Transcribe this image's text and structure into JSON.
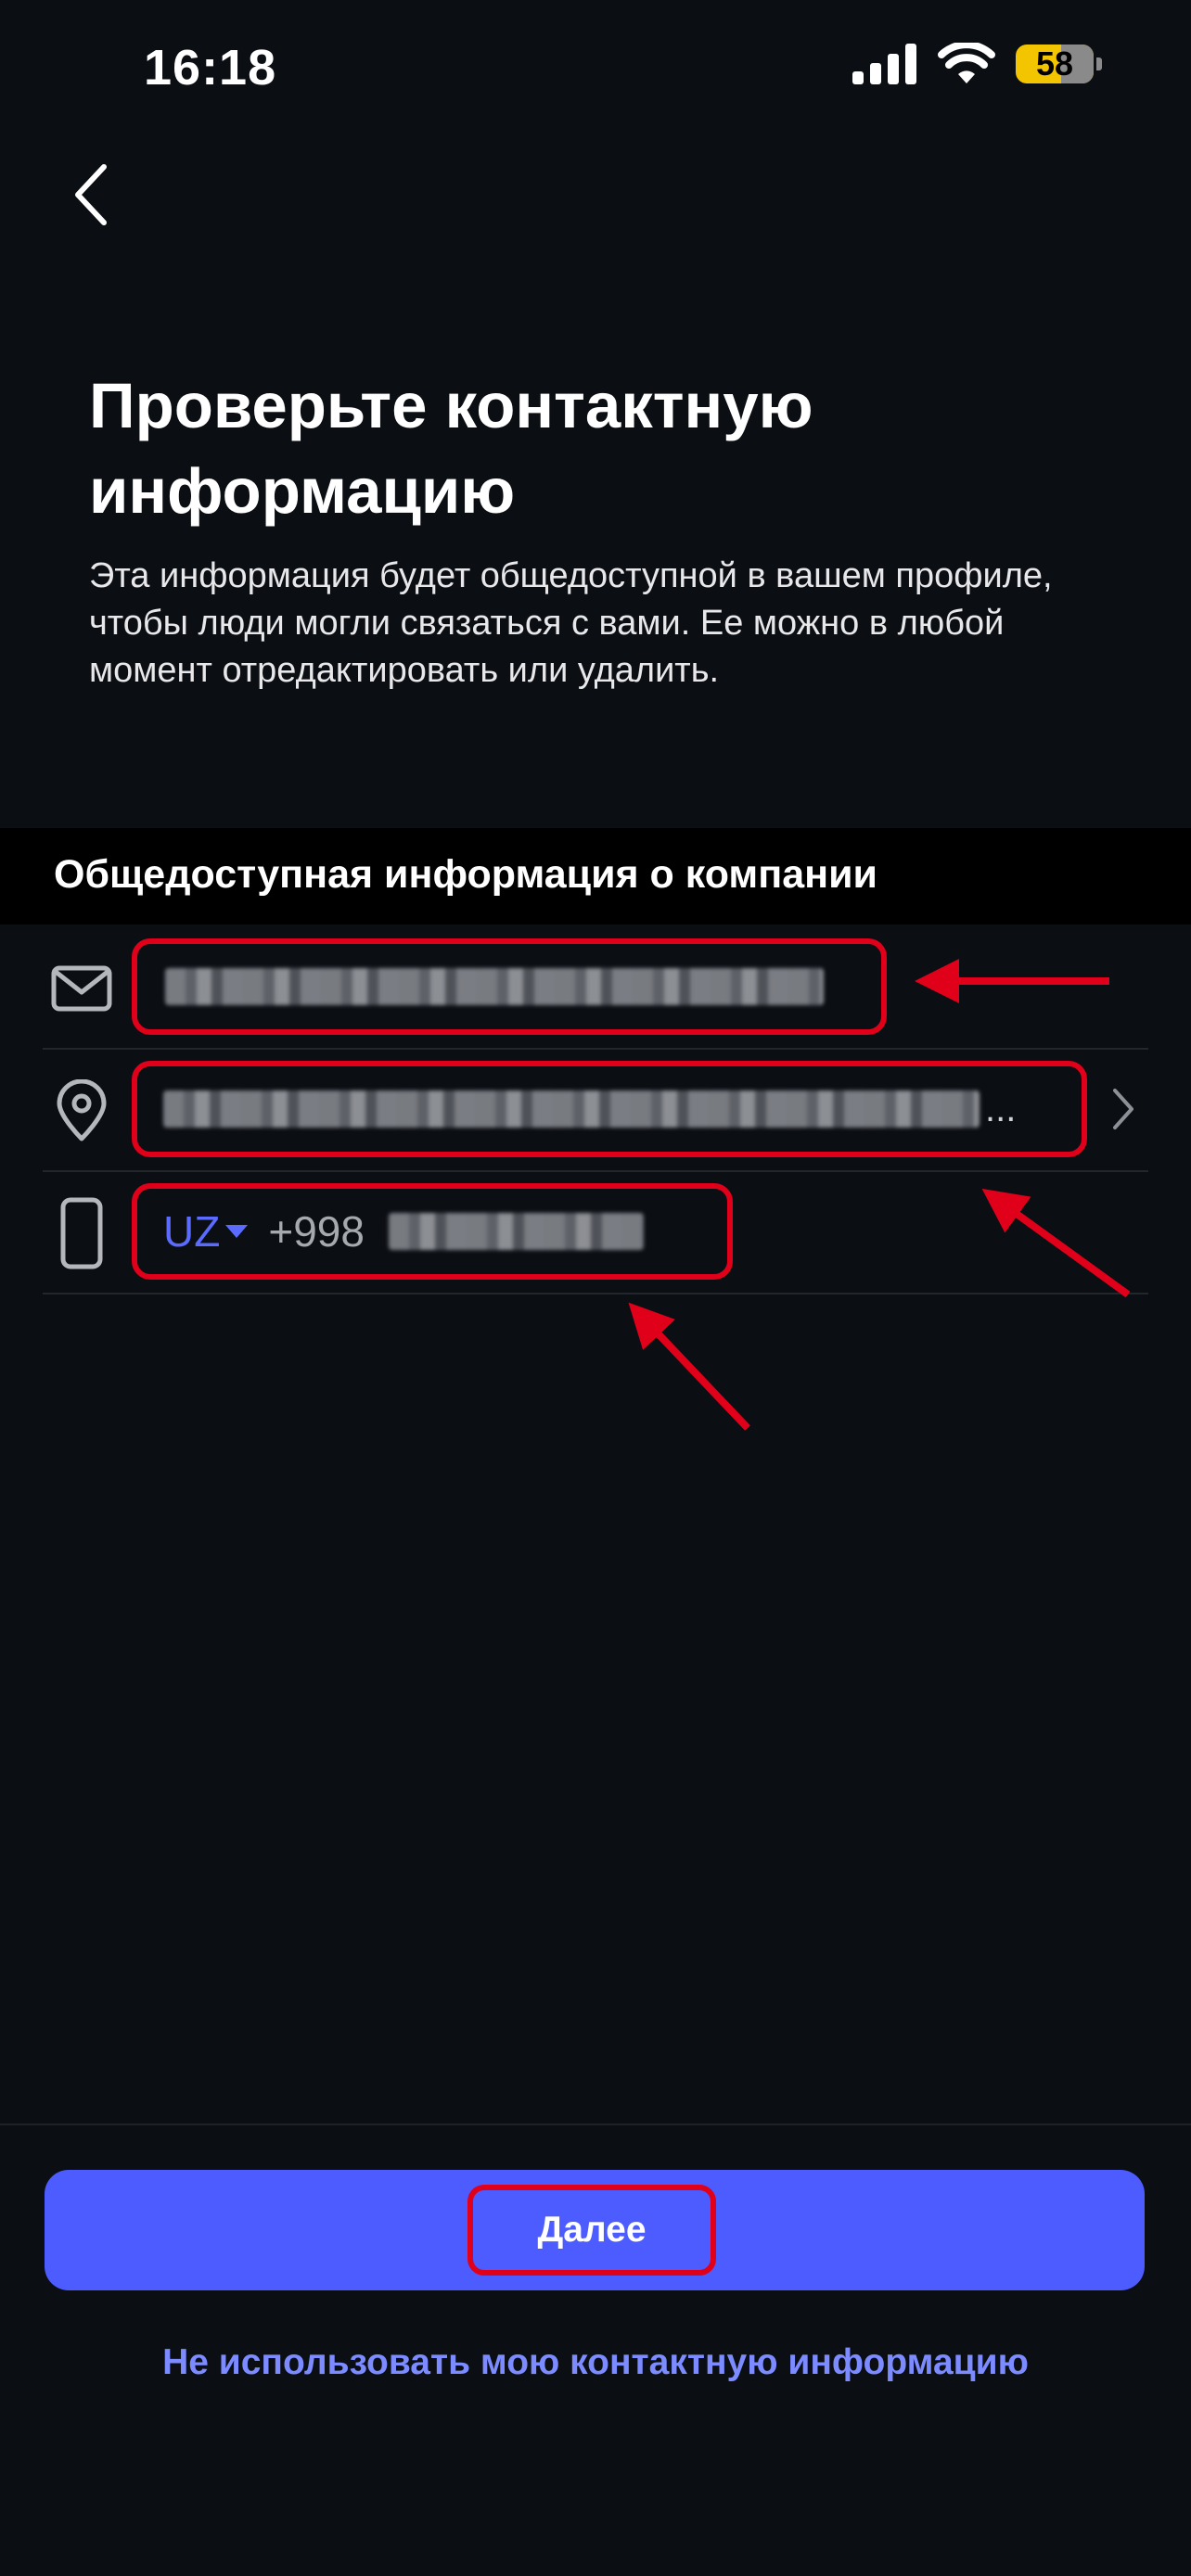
{
  "status_bar": {
    "time": "16:18",
    "battery": "58"
  },
  "header": {
    "title": "Проверьте контактную информацию",
    "subtitle": "Эта информация будет общедоступной в вашем профиле, чтобы люди могли связаться с вами. Ее можно в любой момент отредактировать или удалить."
  },
  "section": {
    "title": "Общедоступная информация о компании"
  },
  "rows": {
    "email": {
      "icon": "mail-icon"
    },
    "address": {
      "icon": "location-pin-icon",
      "ellipsis": "..."
    },
    "phone": {
      "icon": "phone-icon",
      "country": "UZ",
      "dial_code": "+998"
    }
  },
  "footer": {
    "next_label": "Далее",
    "skip_label": "Не использовать мою контактную информацию"
  },
  "colors": {
    "accent": "#4c5cff",
    "link": "#7c8bff",
    "annotation": "#e0001a",
    "background": "#0b0e13"
  }
}
